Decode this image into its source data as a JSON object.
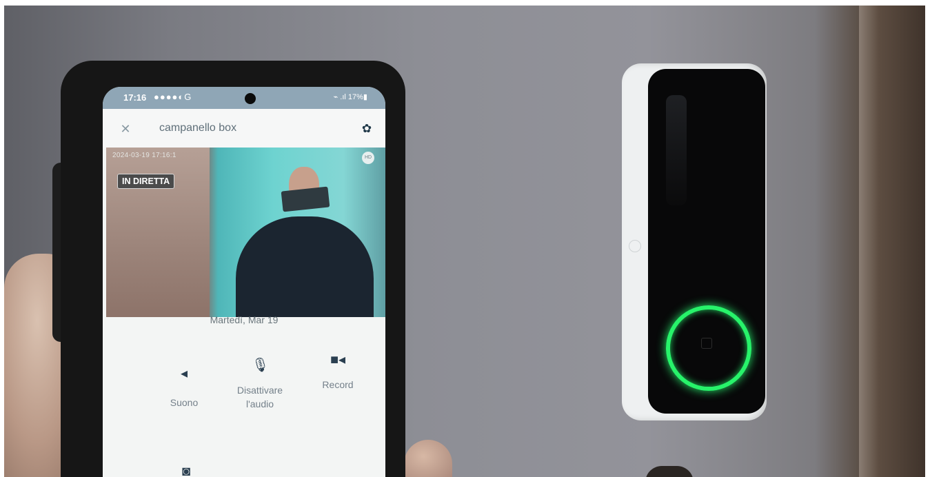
{
  "status_bar": {
    "time": "17:16",
    "icons": "●●●●◐G",
    "right": "⌁ .ıl 17%▮"
  },
  "app_bar": {
    "close_glyph": "✕",
    "title": "campanello box",
    "settings_glyph": "✿"
  },
  "live_view": {
    "timestamp": "2024-03-19 17:16:1",
    "badge": "IN DIRETTA",
    "hd_label": "HD"
  },
  "date": "Martedì, Mar 19",
  "controls": {
    "sound": {
      "label": "Suono",
      "icon": "speaker-muted-icon",
      "glyph": "◂"
    },
    "mute": {
      "label_line1": "Disattivare",
      "label_line2": "l'audio",
      "icon": "microphone-off-icon",
      "glyph": "🎙"
    },
    "record": {
      "label": "Record",
      "icon": "video-camera-icon",
      "glyph": "■◂"
    },
    "snapshot": {
      "icon": "camera-icon",
      "glyph": "◙"
    }
  },
  "colors": {
    "doorbell_ring": "#27f36a",
    "icon_dark": "#2a3f50"
  }
}
